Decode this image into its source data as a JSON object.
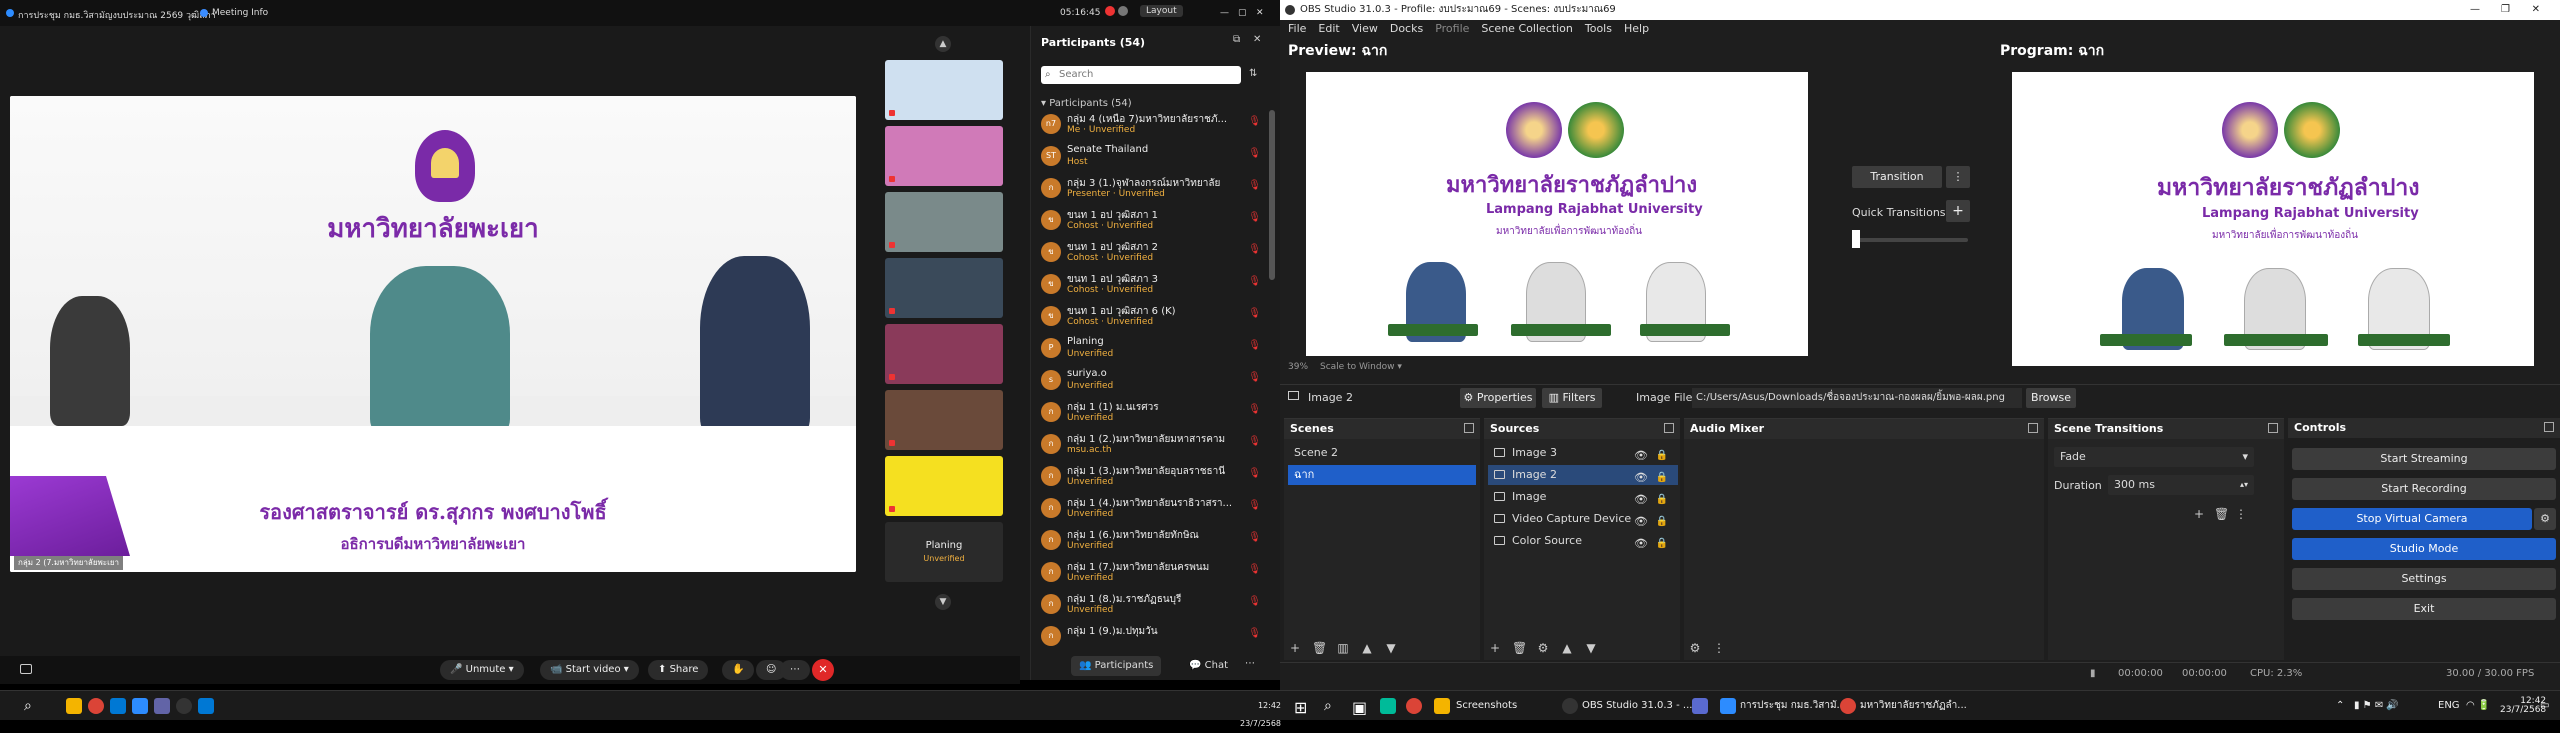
{
  "zoom": {
    "title": "การประชุม กมธ.วิสามัญงบประมาณ 2569 วุฒิสภา",
    "meeting_info": "Meeting Info",
    "time": "05:16:45",
    "layout": "Layout",
    "video": {
      "university": "มหาวิทยาลัยพะเยา",
      "speaker_name": "รองศาสตราจารย์ ดร.สุภกร พงศบางโพธิ์",
      "speaker_title": "อธิการบดีมหาวิทยาลัยพะเยา",
      "tile_label": "กลุ่ม 2 (7.มหาวิทยาลัยพะเยา"
    },
    "tiles": {
      "last_label": "Planing",
      "last_status": "Unverified"
    },
    "bottom": {
      "unmute": "Unmute",
      "start_video": "Start video",
      "share": "Share",
      "participants": "Participants",
      "chat": "Chat"
    },
    "participants": {
      "header": "Participants (54)",
      "search_placeholder": "Search",
      "subheader": "Participants (54)",
      "list": [
        {
          "name": "กลุ่ม 4 (เหนือ 7)มหาวิทยาลัยราชภั...",
          "role": "Me · Unverified",
          "av": "n7"
        },
        {
          "name": "Senate Thailand",
          "role": "Host",
          "av": "ST"
        },
        {
          "name": "กลุ่ม 3 (1.)จุฬาลงกรณ์มหาวิทยาลัย",
          "role": "Presenter · Unverified",
          "av": "ก"
        },
        {
          "name": "ขนท 1 อป วุฒิสภา 1",
          "role": "Cohost · Unverified",
          "av": "ข"
        },
        {
          "name": "ขนท 1 อป วุฒิสภา 2",
          "role": "Cohost · Unverified",
          "av": "ข"
        },
        {
          "name": "ขนท 1 อป วุฒิสภา 3",
          "role": "Cohost · Unverified",
          "av": "ข"
        },
        {
          "name": "ขนท 1 อป วุฒิสภา 6 (K)",
          "role": "Cohost · Unverified",
          "av": "ข"
        },
        {
          "name": "Planing",
          "role": "Unverified",
          "av": "P"
        },
        {
          "name": "suriya.o",
          "role": "Unverified",
          "av": "s"
        },
        {
          "name": "กลุ่ม 1 (1) ม.นเรศวร",
          "role": "Unverified",
          "av": "ก"
        },
        {
          "name": "กลุ่ม 1 (2.)มหาวิทยาลัยมหาสารคาม",
          "role": "msu.ac.th",
          "av": "ก"
        },
        {
          "name": "กลุ่ม 1 (3.)มหาวิทยาลัยอุบลราชธานี",
          "role": "Unverified",
          "av": "ก"
        },
        {
          "name": "กลุ่ม 1 (4.)มหาวิทยาลัยนราธิวาสรา...",
          "role": "Unverified",
          "av": "ก"
        },
        {
          "name": "กลุ่ม 1 (6.)มหาวิทยาลัยทักษิณ",
          "role": "Unverified",
          "av": "ก"
        },
        {
          "name": "กลุ่ม 1 (7.)มหาวิทยาลัยนครพนม",
          "role": "Unverified",
          "av": "ก"
        },
        {
          "name": "กลุ่ม 1 (8.)ม.ราชภัฏธนบุรี",
          "role": "Unverified",
          "av": "ก"
        },
        {
          "name": "กลุ่ม 1 (9.)ม.ปทุมวัน",
          "role": "",
          "av": "ก"
        }
      ]
    }
  },
  "obs": {
    "title": "OBS Studio 31.0.3 - Profile: งบประมาณ69 - Scenes: งบประมาณ69",
    "menu": [
      "File",
      "Edit",
      "View",
      "Docks",
      "Profile",
      "Scene Collection",
      "Tools",
      "Help"
    ],
    "preview_label": "Preview: ฉาก",
    "program_label": "Program: ฉาก",
    "canvas": {
      "thai_name": "มหาวิทยาลัยราชภัฏลำปาง",
      "english_name": "Lampang Rajabhat University",
      "slogan": "มหาวิทยาลัยเพื่อการพัฒนาท้องถิ่น"
    },
    "transition_btn": "Transition",
    "quick_transitions": "Quick Transitions",
    "zoom_pct": "39%",
    "scale_mode": "Scale to Window",
    "selected_source": "Image 2",
    "properties": "Properties",
    "filters": "Filters",
    "image_file_label": "Image File",
    "image_file_path": "C:/Users/Asus/Downloads/ชื่อจองประมาณ-กองผลผ/ยิ้มพอ-ผลผ.png",
    "browse": "Browse",
    "docks": {
      "scenes": "Scenes",
      "sources": "Sources",
      "audio_mixer": "Audio Mixer",
      "scene_transitions": "Scene Transitions",
      "controls": "Controls"
    },
    "scenes": [
      "Scene 2",
      "ฉาก"
    ],
    "sources": [
      "Image 3",
      "Image 2",
      "Image",
      "Video Capture Device",
      "Color Source"
    ],
    "transitions": {
      "type": "Fade",
      "duration_label": "Duration",
      "duration": "300 ms"
    },
    "controls": [
      "Start Streaming",
      "Start Recording",
      "Stop Virtual Camera",
      "Studio Mode",
      "Settings",
      "Exit"
    ],
    "status": {
      "t1": "00:00:00",
      "t2": "00:00:00",
      "cpu": "CPU: 2.3%",
      "fps": "30.00 / 30.00 FPS"
    }
  },
  "taskbar": {
    "left_time": "12:42",
    "left_date": "23/7/2568",
    "items": [
      "Screenshots",
      "OBS Studio 31.0.3 - ...",
      "การประชุม กมธ.วิสามั...",
      "มหาวิทยาลัยราชภัฏลำ..."
    ],
    "lang": "ENG",
    "time": "12:42",
    "date": "23/7/2568"
  }
}
